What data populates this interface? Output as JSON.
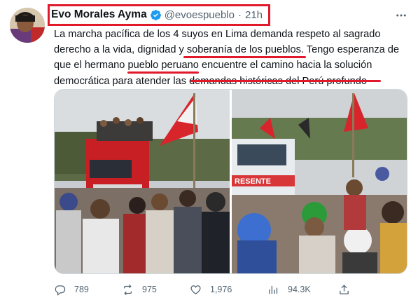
{
  "author": {
    "name": "Evo Morales Ayma",
    "handle": "@evoespueblo",
    "separator": "·",
    "time": "21h",
    "verified": true
  },
  "tweet": {
    "lines": [
      "La marcha pacífica de los 4 suyos en Lima demanda respeto al sagrado",
      "derecho a la vida, dignidad y soberanía de los pueblos. Tengo esperanza de",
      "que el hermano pueblo peruano encuentre el camino hacia la solución",
      "democrática para atender las demandas históricas del Perú profundo"
    ]
  },
  "media": {
    "left_photo": {
      "icon": "march-photo-truck"
    },
    "right_photo": {
      "icon": "march-photo-crowd",
      "banner_text": "RESENTE"
    }
  },
  "actions": {
    "reply": {
      "icon": "reply-icon",
      "count": "789"
    },
    "retweet": {
      "icon": "retweet-icon",
      "count": "975"
    },
    "like": {
      "icon": "heart-icon",
      "count": "1,976"
    },
    "views": {
      "icon": "views-icon",
      "count": "94.3K"
    },
    "share": {
      "icon": "share-icon"
    }
  },
  "colors": {
    "annotation_red": "#e0192b",
    "verified_blue": "#1d9bf0",
    "secondary_text": "#536471"
  }
}
